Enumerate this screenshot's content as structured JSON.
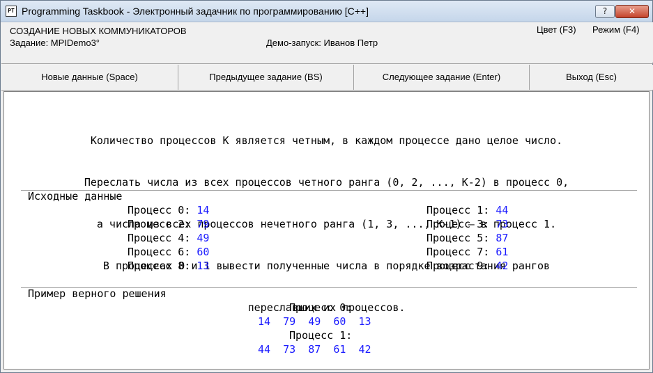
{
  "window": {
    "title": "Programming Taskbook - Электронный задачник по программированию [C++]",
    "icon_text": "PT",
    "help_label": "?",
    "close_label": "✕"
  },
  "info": {
    "section_title": "СОЗДАНИЕ НОВЫХ КОММУНИКАТОРОВ",
    "task": "Задание: MPIDemo3°",
    "demo": "Демо-запуск: Иванов Петр",
    "color_label": "Цвет (F3)",
    "mode_label": "Режим (F4)"
  },
  "buttons": {
    "new_data": "Новые данные (Space)",
    "prev_task": "Предыдущее задание (BS)",
    "next_task": "Следующее задание (Enter)",
    "exit": "Выход (Esc)"
  },
  "description": [
    "Количество процессов K является четным, в каждом процессе дано целое число.",
    "Переслать числа из всех процессов четного ранга (0, 2, ..., K-2) в процесс 0,",
    "а числа из всех процессов нечетного ранга (1, 3, ..., K-1) — в процесс 1.",
    "В процессах 0 и 1 вывести полученные числа в порядке возрастания рангов",
    "переславших их процессов."
  ],
  "input_section": {
    "label": "Исходные данные",
    "left": [
      {
        "label": "Процесс 0:",
        "value": "14"
      },
      {
        "label": "Процесс 2:",
        "value": "79"
      },
      {
        "label": "Процесс 4:",
        "value": "49"
      },
      {
        "label": "Процесс 6:",
        "value": "60"
      },
      {
        "label": "Процесс 8:",
        "value": "13"
      }
    ],
    "right": [
      {
        "label": "Процесс 1:",
        "value": "44"
      },
      {
        "label": "Процесс 3:",
        "value": "73"
      },
      {
        "label": "Процесс 5:",
        "value": "87"
      },
      {
        "label": "Процесс 7:",
        "value": "61"
      },
      {
        "label": "Процесс 9:",
        "value": "42"
      }
    ]
  },
  "solution_section": {
    "label": "Пример верного решения",
    "process0_label": "Процесс 0:",
    "process0_values": "14  79  49  60  13",
    "process1_label": "Процесс 1:",
    "process1_values": "44  73  87  61  42"
  }
}
